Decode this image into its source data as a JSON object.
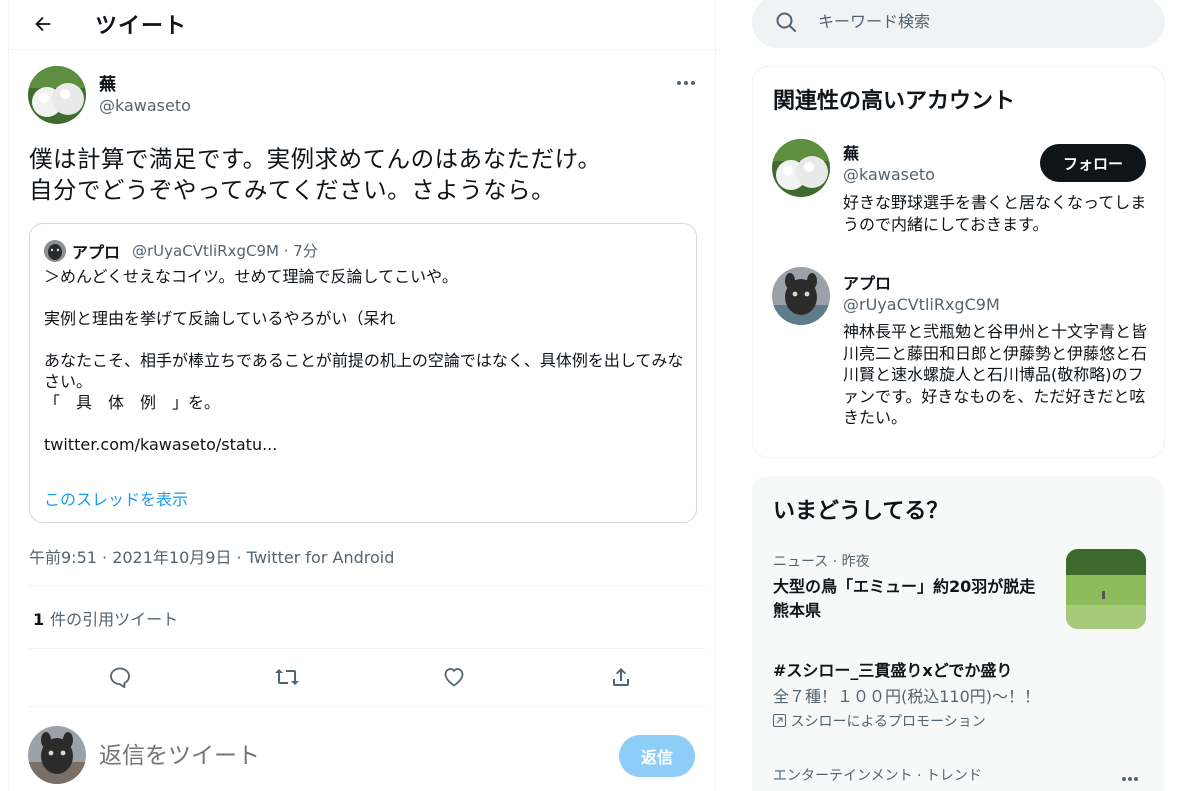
{
  "header": {
    "title": "ツイート"
  },
  "tweet": {
    "author_name": "蕪",
    "author_handle": "@kawaseto",
    "text": "僕は計算で満足です。実例求めてんのはあなただけ。\n自分でどうぞやってみてください。さようなら。",
    "timestamp": "午前9:51 · 2021年10月9日 · Twitter for Android",
    "quote_count": "1",
    "quote_count_label": "件の引用ツイート"
  },
  "quoted_tweet": {
    "name": "アプロ",
    "meta": "@rUyaCVtliRxgC9M · 7分",
    "body": "＞めんどくせえなコイツ。せめて理論で反論してこいや。\n\n実例と理由を挙げて反論しているやろがい（呆れ\n\nあなたこそ、相手が棒立ちであることが前提の机上の空論ではなく、具体例を出してみなさい。\n「　具　体　例　」を。\n\ntwitter.com/kawaseto/statu...",
    "show_thread": "このスレッドを表示"
  },
  "reply": {
    "placeholder": "返信をツイート",
    "button_label": "返信"
  },
  "search": {
    "placeholder": "キーワード検索"
  },
  "related_accounts": {
    "title": "関連性の高いアカウント",
    "follow_label": "フォロー",
    "accounts": [
      {
        "name": "蕪",
        "handle": "@kawaseto",
        "bio": "好きな野球選手を書くと居なくなってしまうので内緒にしておきます。"
      },
      {
        "name": "アプロ",
        "handle": "@rUyaCVtliRxgC9M",
        "bio": "神林長平と弐瓶勉と谷甲州と十文字青と皆川亮二と藤田和日郎と伊藤勢と伊藤悠と石川賢と速水螺旋人と石川博品(敬称略)のファンです。好きなものを、ただ好きだと呟きたい。"
      }
    ]
  },
  "trends": {
    "title": "いまどうしてる？",
    "items": [
      {
        "meta": "ニュース · 昨夜",
        "title": "大型の鳥「エミュー」約20羽が脱走 熊本県"
      },
      {
        "title": "#スシロー_三貫盛りxどでか盛り",
        "desc": "全７種！１００円(税込110円)〜！！",
        "promo": "スシローによるプロモーション"
      },
      {
        "meta": "エンターテインメント · トレンド"
      }
    ]
  },
  "colors": {
    "accent": "#1d9bf0",
    "reply_button": "#8ecdf8",
    "text": "#0f1419",
    "muted": "#536471"
  }
}
